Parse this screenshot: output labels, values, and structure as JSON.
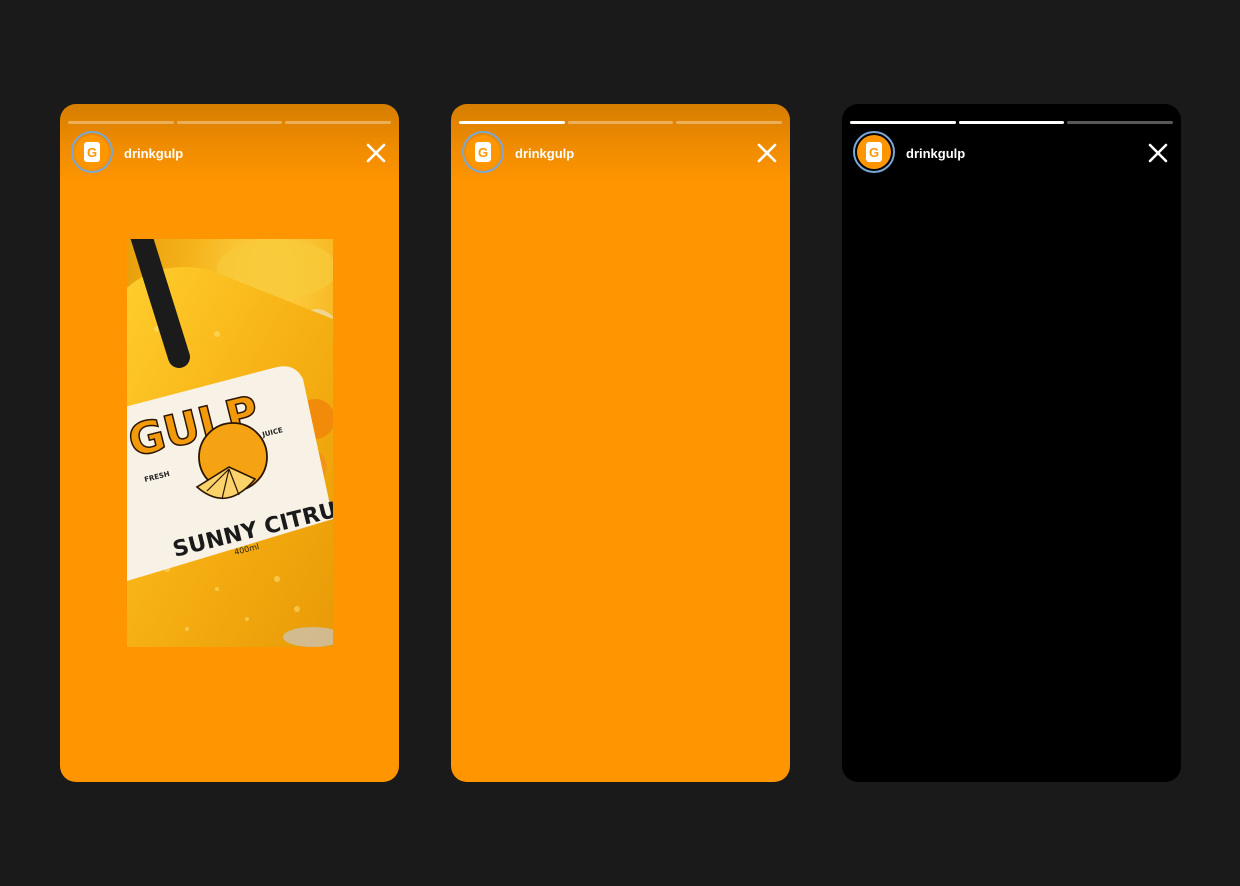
{
  "stories": [
    {
      "username": "drinkgulp",
      "avatar_letter": "G",
      "progress": [
        0,
        0,
        0
      ],
      "theme": "orange",
      "media": {
        "brand": "GULP",
        "tag_left": "FRESH",
        "tag_right": "JUICE",
        "product": "SUNNY CITRUS",
        "volume": "400ml"
      }
    },
    {
      "username": "drinkgulp",
      "avatar_letter": "G",
      "progress": [
        1,
        0,
        0
      ],
      "theme": "orange"
    },
    {
      "username": "drinkgulp",
      "avatar_letter": "G",
      "progress": [
        1,
        1,
        0
      ],
      "theme": "black"
    }
  ],
  "icons": {
    "close": "close-icon",
    "logo": "gulp-logo-icon"
  },
  "colors": {
    "page_bg": "#1a1a1a",
    "brand_orange": "#ff9500",
    "story_black": "#000000",
    "avatar_ring": "#7aa7d6"
  }
}
